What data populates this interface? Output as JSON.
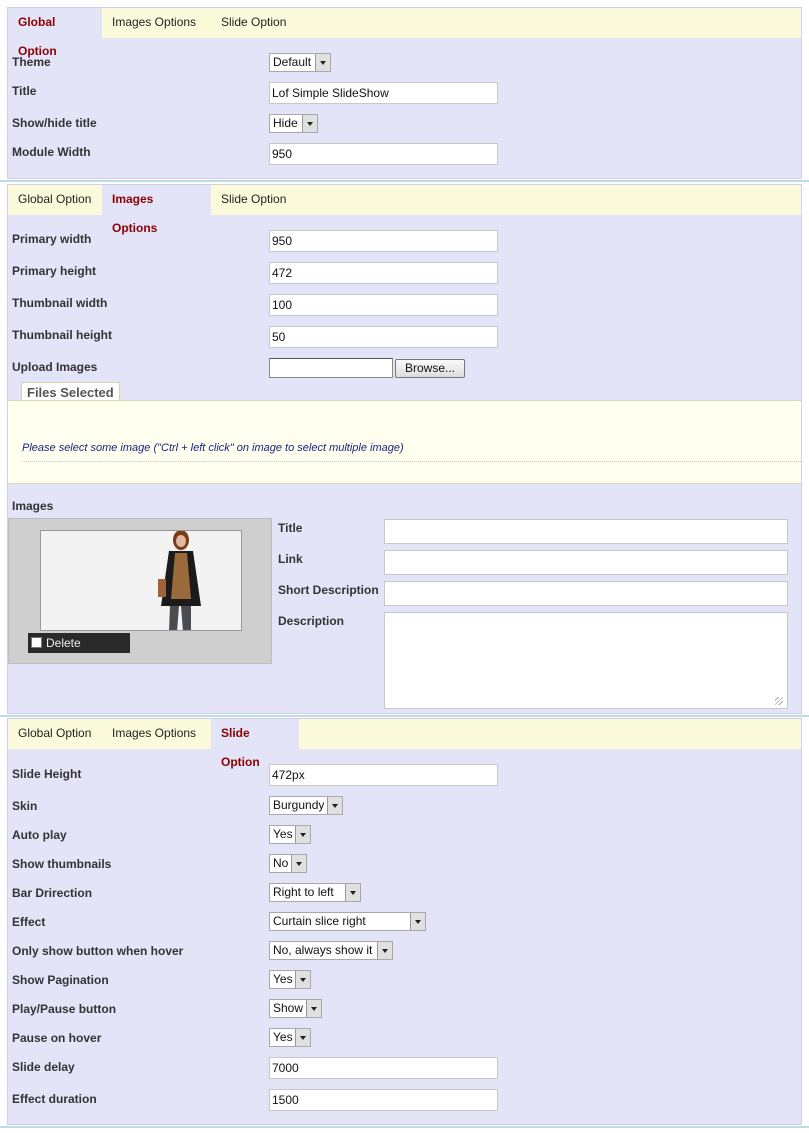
{
  "tabs": {
    "global": "Global Option",
    "images": "Images Options",
    "slide": "Slide Option"
  },
  "global": {
    "theme_label": "Theme",
    "theme_value": "Default",
    "title_label": "Title",
    "title_value": "Lof Simple SlideShow",
    "showhide_label": "Show/hide title",
    "showhide_value": "Hide",
    "width_label": "Module Width",
    "width_value": "950"
  },
  "images": {
    "primary_width_label": "Primary width",
    "primary_width_value": "950",
    "primary_height_label": "Primary height",
    "primary_height_value": "472",
    "thumb_width_label": "Thumbnail width",
    "thumb_width_value": "100",
    "thumb_height_label": "Thumbnail height",
    "thumb_height_value": "50",
    "upload_label": "Upload Images",
    "browse_label": "Browse...",
    "files_selected_label": "Files Selected",
    "hint": "Please select some image (\"Ctrl + left click\" on image to select multiple image)",
    "images_label": "Images",
    "delete_label": "Delete",
    "item_title_label": "Title",
    "item_link_label": "Link",
    "item_short_desc_label": "Short Description",
    "item_desc_label": "Description"
  },
  "slide": {
    "height_label": "Slide Height",
    "height_value": "472px",
    "skin_label": "Skin",
    "skin_value": "Burgundy",
    "autoplay_label": "Auto play",
    "autoplay_value": "Yes",
    "thumbs_label": "Show thumbnails",
    "thumbs_value": "No",
    "bardir_label": "Bar Drirection",
    "bardir_value": "Right to left",
    "effect_label": "Effect",
    "effect_value": "Curtain slice right",
    "hover_btn_label": "Only show button when hover",
    "hover_btn_value": "No, always show it",
    "pagination_label": "Show Pagination",
    "pagination_value": "Yes",
    "playpause_label": "Play/Pause button",
    "playpause_value": "Show",
    "pause_hover_label": "Pause on hover",
    "pause_hover_value": "Yes",
    "delay_label": "Slide delay",
    "delay_value": "7000",
    "duration_label": "Effect duration",
    "duration_value": "1500"
  },
  "colors": {
    "panel_bg": "#e4e4f8",
    "tab_bar_bg": "#fbfbdc",
    "active_tab_text": "#8b0000",
    "hint_text": "#1a237e"
  }
}
